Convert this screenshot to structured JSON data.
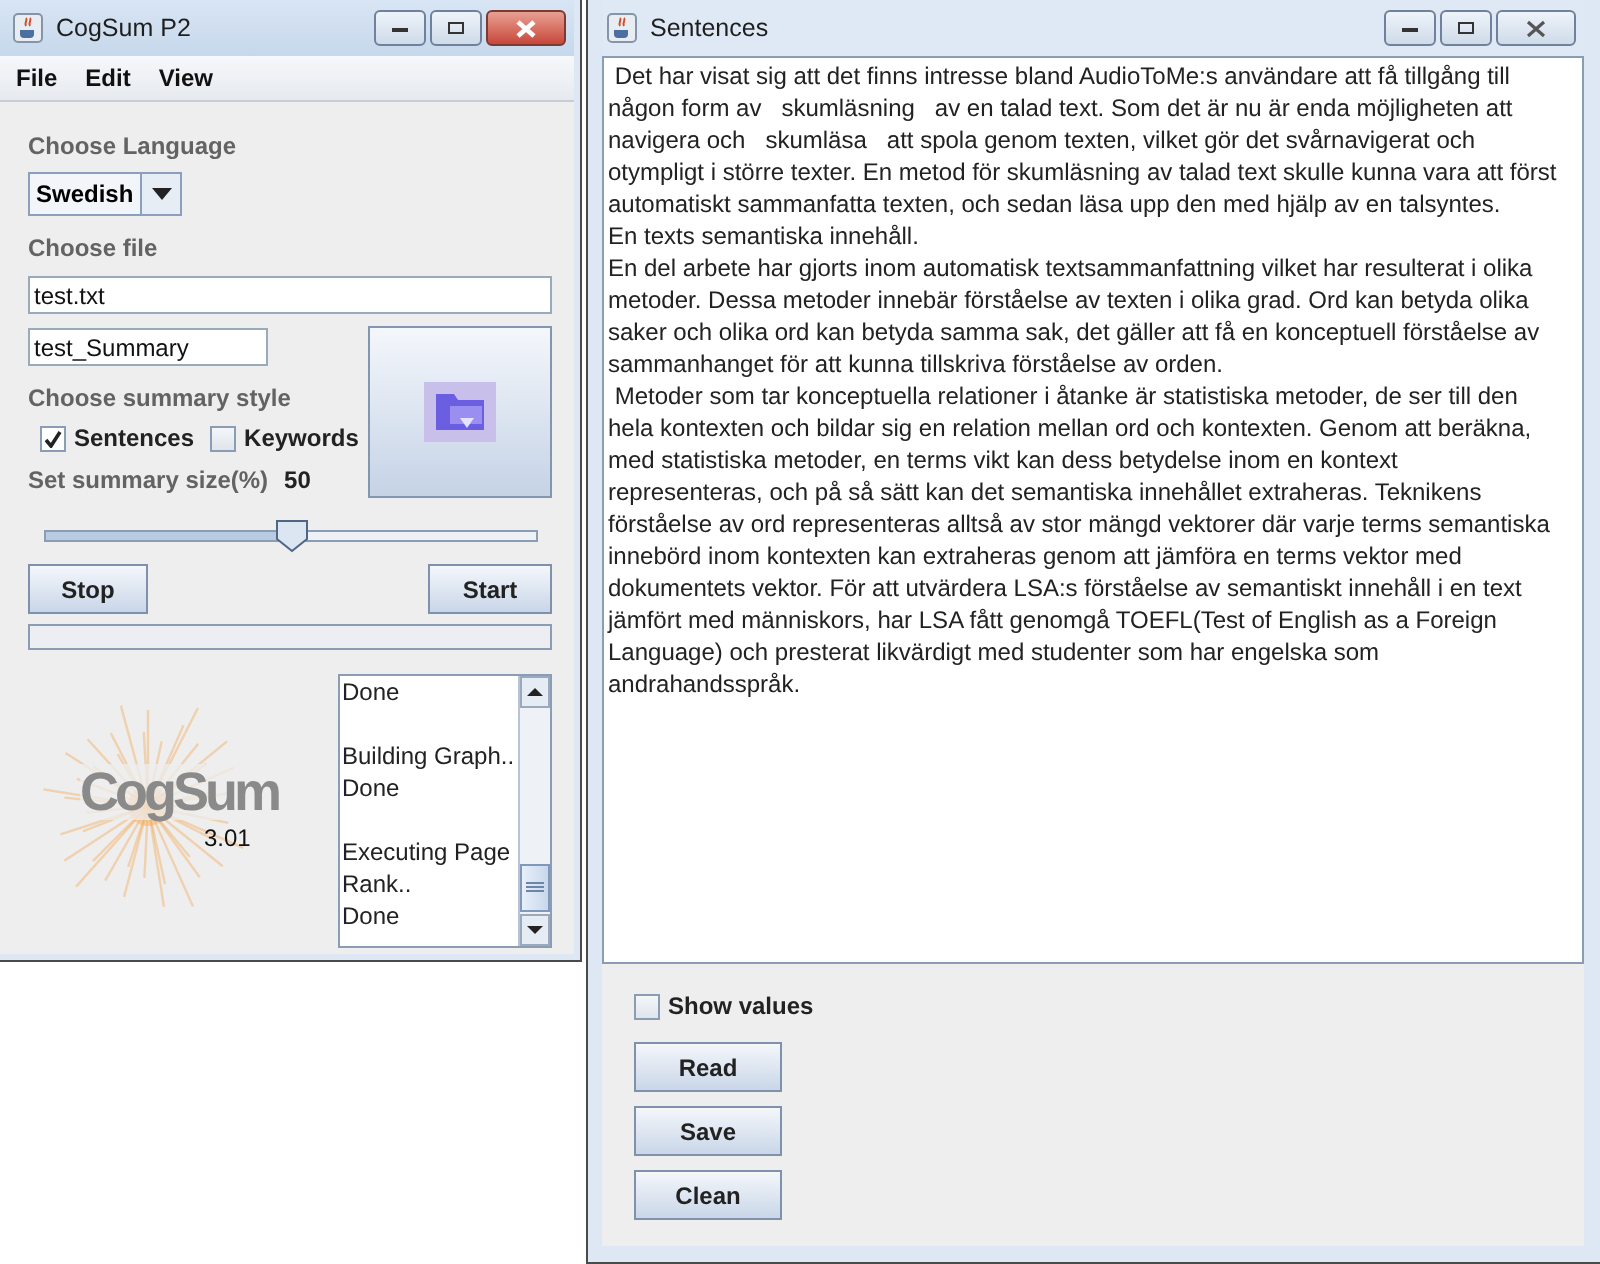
{
  "main_window": {
    "title": "CogSum P2",
    "active": true,
    "menu": [
      "File",
      "Edit",
      "View"
    ],
    "language_label": "Choose Language",
    "language": {
      "value": "Swedish"
    },
    "file_label": "Choose file",
    "file_field": {
      "value": "test.txt"
    },
    "output_field": {
      "value": "test_Summary"
    },
    "style_label": "Choose summary style",
    "style_options": [
      {
        "label": "Sentences",
        "checked": true
      },
      {
        "label": "Keywords",
        "checked": false
      }
    ],
    "size_label": "Set summary size(%)",
    "size_value": "50",
    "slider": {
      "level": 0.5
    },
    "buttons": [
      "Stop",
      "Start"
    ],
    "progress": {
      "level": 0
    },
    "logo": {
      "name": "CogSum",
      "version": "3.01"
    },
    "log": [
      {
        "lines": [
          "Done"
        ]
      },
      {
        "lines": [
          "Building Graph..",
          "Done"
        ]
      },
      {
        "lines": [
          "Executing Page",
          "Rank..",
          "Done"
        ]
      }
    ]
  },
  "sentences_window": {
    "title": "Sentences",
    "active": false,
    "lines": [
      " Det har visat sig att det finns intresse bland AudioToMe:s användare att få tillgång till",
      "någon form av   skumläsning   av en talad text. Som det är nu är enda möjligheten att",
      "navigera och   skumläsa   att spola genom texten, vilket gör det svårnavigerat och",
      "otympligt i större texter. En metod för skumläsning av talad text skulle kunna vara att först",
      "automatiskt sammanfatta texten, och sedan läsa upp den med hjälp av en talsyntes.",
      "En texts semantiska innehåll.",
      "En del arbete har gjorts inom automatisk textsammanfattning vilket har resulterat i olika",
      "metoder. Dessa metoder innebär förståelse av texten i olika grad. Ord kan betyda olika",
      "saker och olika ord kan betyda samma sak, det gäller att få en konceptuell förståelse av",
      "sammanhanget för att kunna tillskriva förståelse av orden.",
      " Metoder som tar konceptuella relationer i åtanke är statistiska metoder, de ser till den",
      "hela kontexten och bildar sig en relation mellan ord och kontexten. Genom att beräkna,",
      "med statistiska metoder, en terms vikt kan dess betydelse inom en kontext",
      "representeras, och på så sätt kan det semantiska innehållet extraheras. Teknikens",
      "förståelse av ord representeras alltså av stor mängd vektorer där varje terms semantiska",
      "innebörd inom kontexten kan extraheras genom att jämföra en terms vektor med",
      "dokumentets vektor. För att utvärdera LSA:s förståelse av semantiskt innehåll i en text",
      "jämfört med människors, har LSA fått genomgå TOEFL(Test of English as a Foreign",
      "Language) och presterat likvärdigt med studenter som har engelska som",
      "andrahandsspråk."
    ],
    "show_values": {
      "label": "Show values",
      "checked": false
    },
    "buttons": [
      "Read",
      "Save",
      "Clean"
    ]
  }
}
